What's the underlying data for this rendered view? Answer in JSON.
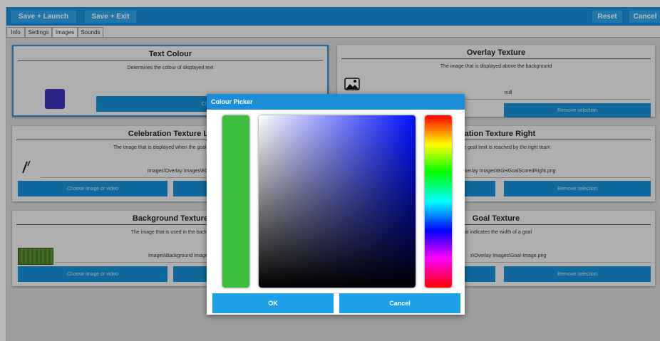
{
  "topbar": {
    "save_launch": "Save + Launch",
    "save_exit": "Save + Exit",
    "reset": "Reset",
    "cancel": "Cancel"
  },
  "tabs": [
    "Info",
    "Settings",
    "Images",
    "Sounds"
  ],
  "active_tab": "Images",
  "panels": {
    "text_colour": {
      "title": "Text Colour",
      "description": "Determines the colour of displayed text",
      "button": "Change",
      "swatch_color": "#3a33b8"
    },
    "overlay_texture": {
      "title": "Overlay Texture",
      "description": "The image that is displayed above the background",
      "value": "null",
      "remove": "Remove selection"
    },
    "celebration_left": {
      "title": "Celebration Texture Le",
      "description": "The image that is displayed when the goal limit is re",
      "value": "Images\\Overlay Images\\BGHGo",
      "choose": "Choose image or video"
    },
    "celebration_right": {
      "title": "oration Texture Right",
      "description": "d when the goal limit is reached by the right team",
      "value": "Overlay Images\\BGHGoalScoredRight.png",
      "remove": "Remove selection"
    },
    "background_texture": {
      "title": "Background Texture",
      "description": "The image that is used in the backg",
      "value": "Images\\Background Images\\chi",
      "choose": "Choose image or video"
    },
    "goal_texture": {
      "title": "Goal Texture",
      "description": "that indicates the width of a goal",
      "value": "s\\Overlay Images\\Goal-Image.png",
      "remove": "Remove selection"
    }
  },
  "dialog": {
    "title": "Colour Picker",
    "selected_color": "#3fbf3f",
    "ok": "OK",
    "cancel": "Cancel"
  },
  "colors": {
    "accent": "#1a8fd8",
    "button": "#1591d6"
  }
}
